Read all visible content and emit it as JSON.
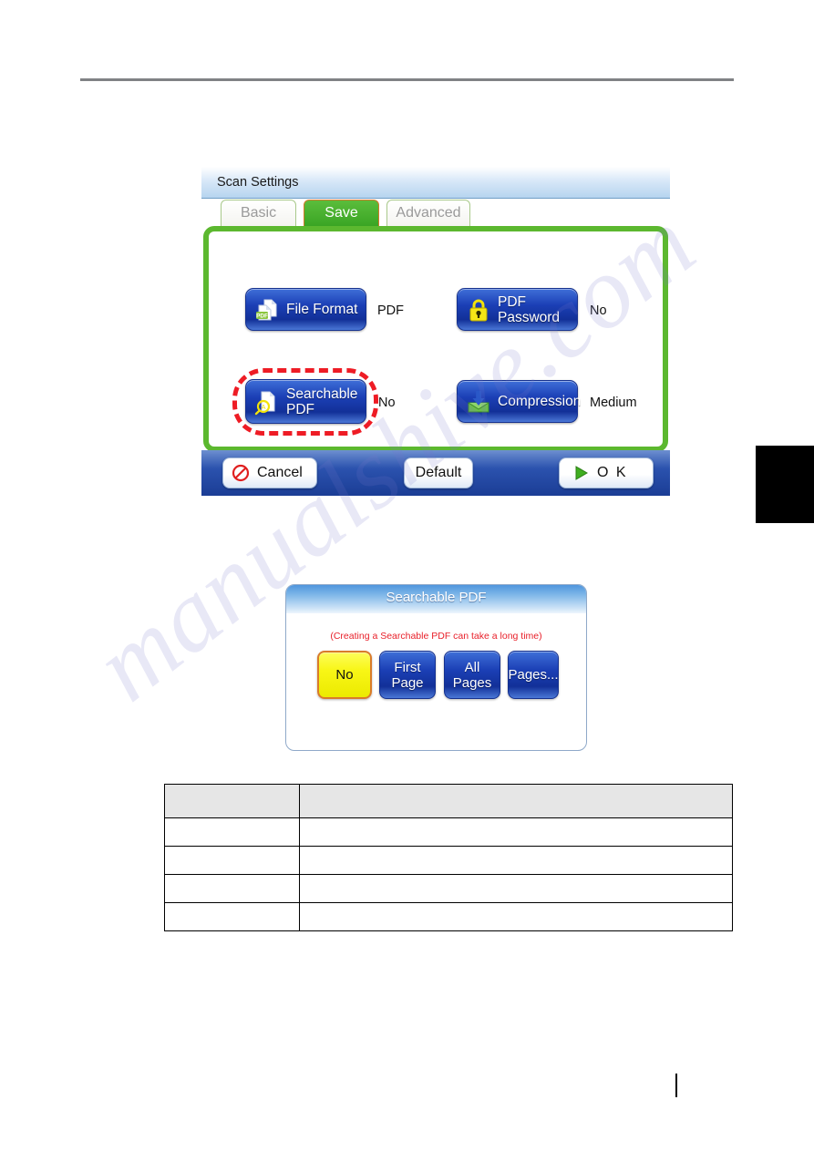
{
  "page": {
    "watermark_text": "manualshive.com"
  },
  "scan_settings": {
    "title": "Scan Settings",
    "tabs": [
      {
        "label": "Basic",
        "selected": false
      },
      {
        "label": "Save",
        "selected": true
      },
      {
        "label": "Advanced",
        "selected": false
      }
    ],
    "settings": [
      {
        "icon": "pdf-document-icon",
        "label_line1": "File Format",
        "label_line2": "",
        "value": "PDF"
      },
      {
        "icon": "padlock-icon",
        "label_line1": "PDF",
        "label_line2": "Password",
        "value": "No"
      },
      {
        "icon": "searchable-document-icon",
        "label_line1": "Searchable",
        "label_line2": "PDF",
        "value": "No"
      },
      {
        "icon": "compression-icon",
        "label_line1": "Compression",
        "label_line2": "",
        "value": "Medium"
      }
    ],
    "footer": {
      "cancel_label": "Cancel",
      "cancel_icon": "prohibition-icon",
      "default_label": "Default",
      "ok_label": "O K",
      "ok_icon": "play-triangle-icon"
    }
  },
  "searchable_pdf_dialog": {
    "title": "Searchable PDF",
    "note": "(Creating a Searchable PDF can take a long time)",
    "options": [
      {
        "label_line1": "No",
        "label_line2": "",
        "selected": true
      },
      {
        "label_line1": "First",
        "label_line2": "Page",
        "selected": false
      },
      {
        "label_line1": "All",
        "label_line2": "Pages",
        "selected": false
      },
      {
        "label_line1": "Pages...",
        "label_line2": "",
        "selected": false
      }
    ]
  },
  "spec_table": {
    "headers": [
      "",
      ""
    ],
    "rows": [
      [
        "",
        ""
      ],
      [
        "",
        ""
      ],
      [
        "",
        ""
      ],
      [
        "",
        ""
      ]
    ]
  },
  "colors": {
    "tab_active": "#3aa524",
    "panel_border": "#5cb82f",
    "button_blue": "#1b3fb5",
    "selected_yellow": "#f8f616",
    "highlight_red": "#ee1c25",
    "note_red": "#e8202a"
  }
}
